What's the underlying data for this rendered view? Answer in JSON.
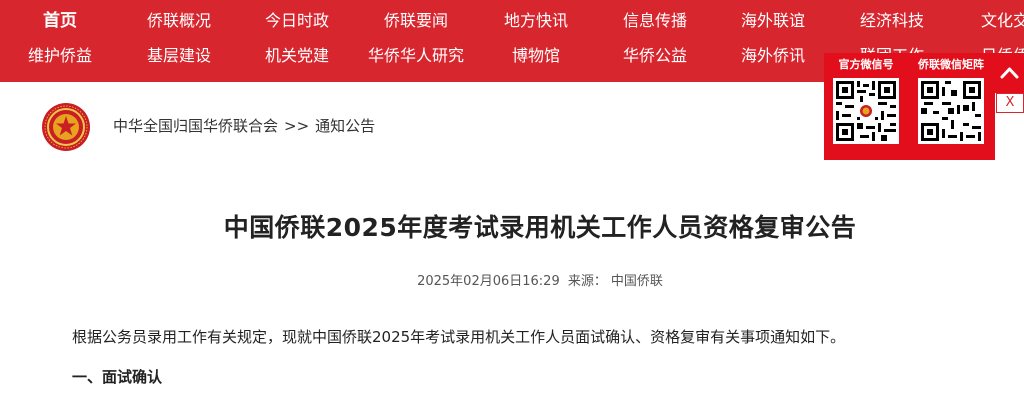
{
  "nav": {
    "row1": [
      "首页",
      "侨联概况",
      "今日时政",
      "侨联要闻",
      "地方快讯",
      "信息传播",
      "海外联谊",
      "经济科技",
      "文化交流"
    ],
    "row2": [
      "维护侨益",
      "基层建设",
      "机关党建",
      "华侨华人研究",
      "博物馆",
      "华侨公益",
      "海外侨讯",
      "联团工作",
      "日侨侨务"
    ]
  },
  "breadcrumb": {
    "home": "中华全国归国华侨联合会",
    "separator": ">>",
    "current": "通知公告"
  },
  "article": {
    "title": "中国侨联2025年度考试录用机关工作人员资格复审公告",
    "date": "2025年02月06日16:29",
    "source_label": "来源：",
    "source": "中国侨联",
    "paragraph1": "根据公务员录用工作有关规定，现就中国侨联2025年考试录用机关工作人员面试确认、资格复审有关事项通知如下。",
    "section1": "一、面试确认"
  },
  "qr_panel": {
    "label1": "官方微信号",
    "label2": "侨联微信矩阵",
    "close": "X"
  },
  "colors": {
    "nav_bg": "#d8262f",
    "panel_bg": "#e20e1b"
  }
}
